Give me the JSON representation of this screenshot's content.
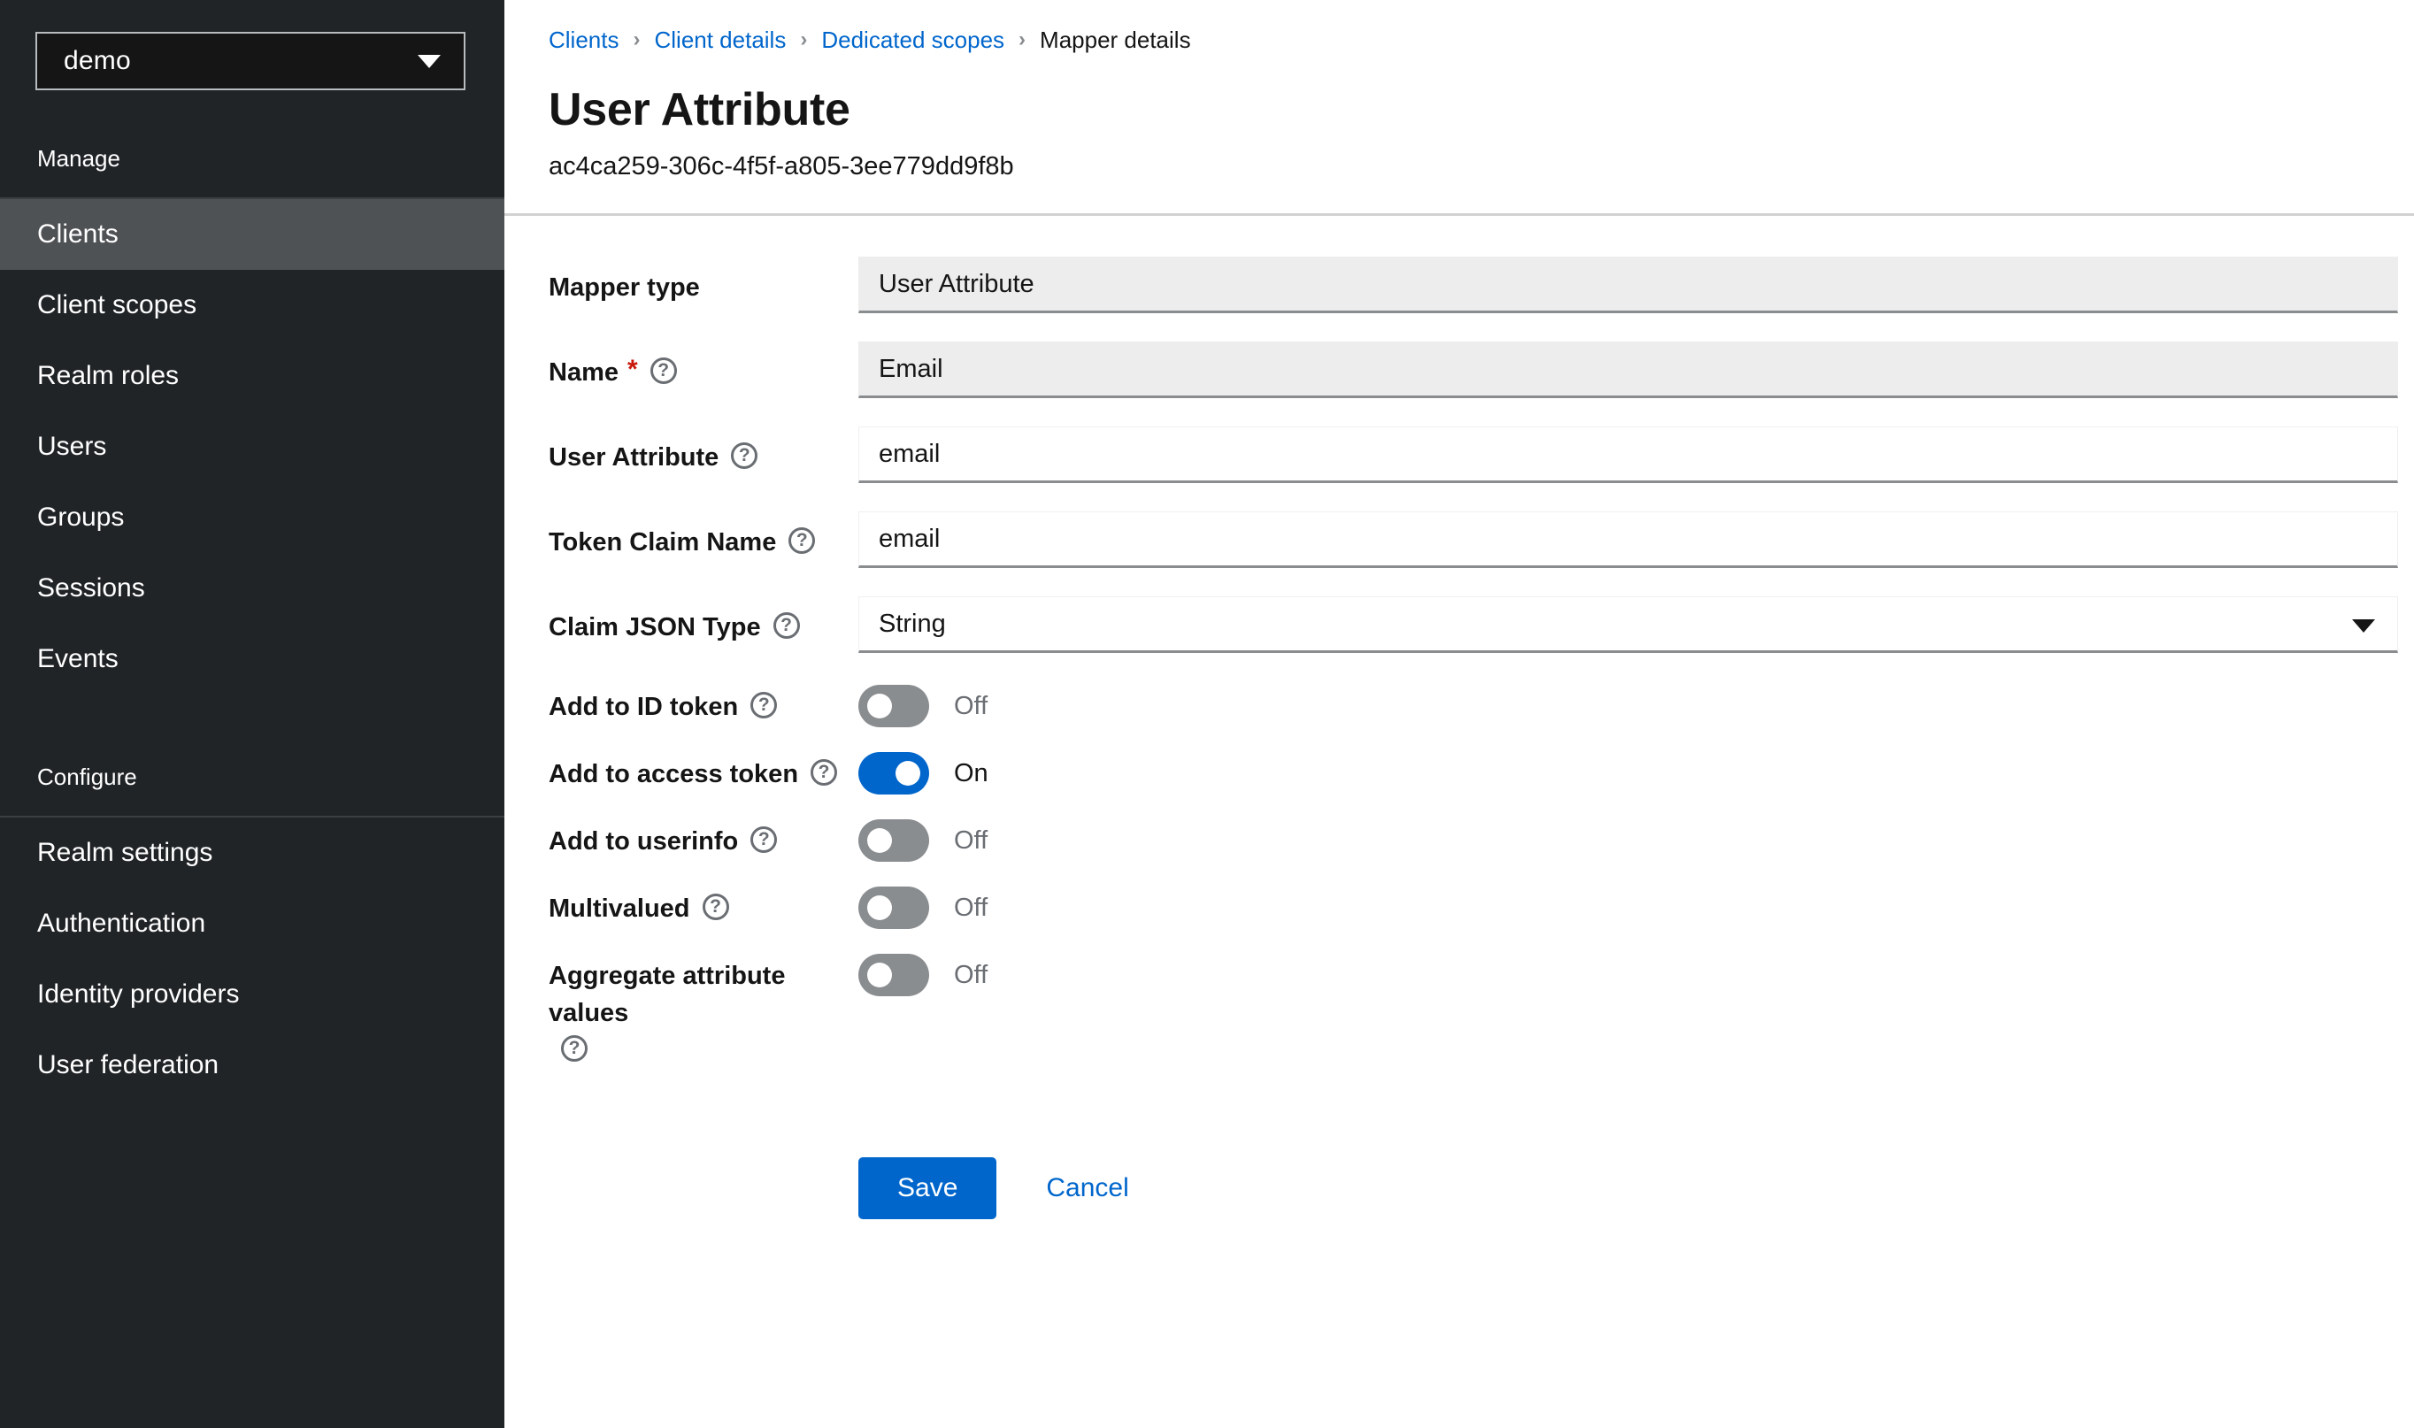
{
  "sidebar": {
    "realm_selector": {
      "value": "demo",
      "caret_icon": "chevron-down-icon"
    },
    "sections": [
      {
        "title": "Manage",
        "items": [
          {
            "label": "Clients",
            "active": true
          },
          {
            "label": "Client scopes",
            "active": false
          },
          {
            "label": "Realm roles",
            "active": false
          },
          {
            "label": "Users",
            "active": false
          },
          {
            "label": "Groups",
            "active": false
          },
          {
            "label": "Sessions",
            "active": false
          },
          {
            "label": "Events",
            "active": false
          }
        ]
      },
      {
        "title": "Configure",
        "items": [
          {
            "label": "Realm settings",
            "active": false
          },
          {
            "label": "Authentication",
            "active": false
          },
          {
            "label": "Identity providers",
            "active": false
          },
          {
            "label": "User federation",
            "active": false
          }
        ]
      }
    ]
  },
  "header": {
    "breadcrumb": [
      {
        "label": "Clients",
        "link": true
      },
      {
        "label": "Client details",
        "link": true
      },
      {
        "label": "Dedicated scopes",
        "link": true
      },
      {
        "label": "Mapper details",
        "link": false
      }
    ],
    "separator": "›",
    "title": "User Attribute",
    "subtitle": "ac4ca259-306c-4f5f-a805-3ee779dd9f8b"
  },
  "form": {
    "fields": [
      {
        "label": "Mapper type",
        "value": "User Attribute",
        "type": "text",
        "readonly": true,
        "required": false,
        "help": false
      },
      {
        "label": "Name",
        "value": "Email",
        "type": "text",
        "readonly": true,
        "required": true,
        "help": true
      },
      {
        "label": "User Attribute",
        "value": "email",
        "type": "text",
        "readonly": false,
        "required": false,
        "help": true
      },
      {
        "label": "Token Claim Name",
        "value": "email",
        "type": "text",
        "readonly": false,
        "required": false,
        "help": true
      },
      {
        "label": "Claim JSON Type",
        "value": "String",
        "type": "select",
        "readonly": false,
        "required": false,
        "help": true,
        "caret_icon": "chevron-down-icon"
      }
    ],
    "toggles": [
      {
        "label": "Add to ID token",
        "state": "Off",
        "on": false,
        "help": true
      },
      {
        "label": "Add to access token",
        "state": "On",
        "on": true,
        "help": true
      },
      {
        "label": "Add to userinfo",
        "state": "Off",
        "on": false,
        "help": true
      },
      {
        "label": "Multivalued",
        "state": "Off",
        "on": false,
        "help": true
      },
      {
        "label": "Aggregate attribute values",
        "state": "Off",
        "on": false,
        "help": true
      }
    ],
    "actions": {
      "save_label": "Save",
      "cancel_label": "Cancel"
    }
  },
  "colors": {
    "accent_blue": "#0066cc",
    "sidebar_bg": "#212427",
    "sidebar_active": "#4f5255",
    "required_red": "#c9190b",
    "toggle_off": "#8a8d90",
    "readonly_bg": "#ededed"
  }
}
